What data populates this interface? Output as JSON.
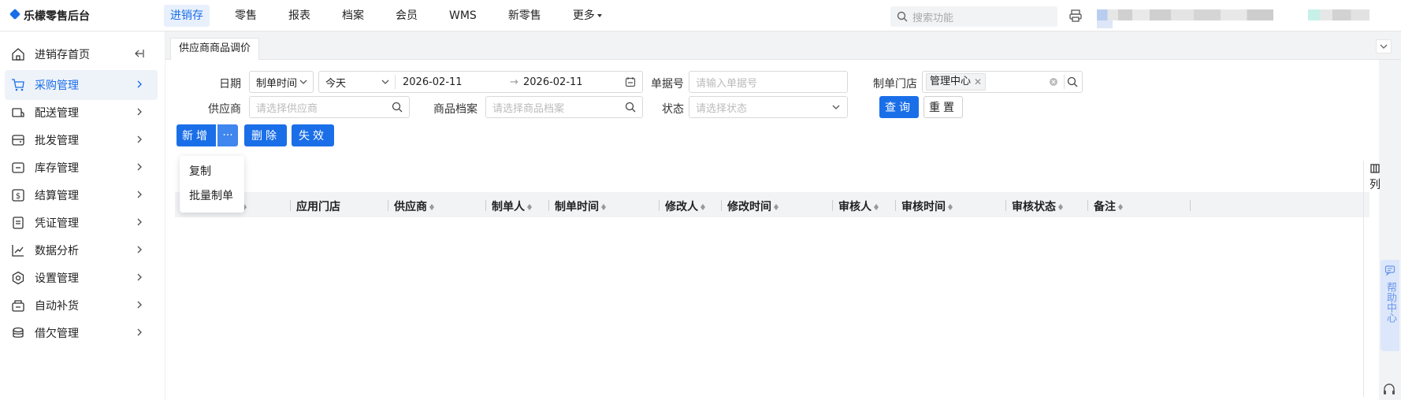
{
  "app": {
    "title": "乐檬零售后台"
  },
  "topnav": {
    "items": [
      {
        "label": "进销存",
        "active": true
      },
      {
        "label": "零售"
      },
      {
        "label": "报表"
      },
      {
        "label": "档案"
      },
      {
        "label": "会员"
      },
      {
        "label": "WMS"
      },
      {
        "label": "新零售"
      },
      {
        "label": "更多"
      }
    ],
    "search_placeholder": "搜索功能"
  },
  "sidebar": {
    "items": [
      {
        "label": "进销存首页",
        "icon": "home-icon"
      },
      {
        "label": "采购管理",
        "icon": "cart-icon",
        "active": true
      },
      {
        "label": "配送管理",
        "icon": "delivery-icon"
      },
      {
        "label": "批发管理",
        "icon": "wallet-icon"
      },
      {
        "label": "库存管理",
        "icon": "inventory-icon"
      },
      {
        "label": "结算管理",
        "icon": "dollar-icon"
      },
      {
        "label": "凭证管理",
        "icon": "voucher-icon"
      },
      {
        "label": "数据分析",
        "icon": "chart-icon"
      },
      {
        "label": "设置管理",
        "icon": "settings-icon"
      },
      {
        "label": "自动补货",
        "icon": "restock-icon"
      },
      {
        "label": "借欠管理",
        "icon": "coins-icon"
      }
    ]
  },
  "tabs": [
    {
      "label": "供应商商品调价"
    }
  ],
  "filters": {
    "date_label": "日期",
    "date_type": "制单时间",
    "date_range_preset": "今天",
    "date_start": "2026-02-11",
    "date_end": "2026-02-11",
    "doc_no_label": "单据号",
    "doc_no_placeholder": "请输入单据号",
    "store_label": "制单门店",
    "store_tag": "管理中心",
    "supplier_label": "供应商",
    "supplier_placeholder": "请选择供应商",
    "product_label": "商品档案",
    "product_placeholder": "请选择商品档案",
    "status_label": "状态",
    "status_placeholder": "请选择状态",
    "query_button": "查询",
    "reset_button": "重置"
  },
  "actions": {
    "add_button": "新增",
    "delete_button": "删除",
    "invalidate_button": "失效",
    "more_menu": [
      "复制",
      "批量制单"
    ]
  },
  "table": {
    "columns": [
      "号",
      "应用门店",
      "供应商",
      "制单人",
      "制单时间",
      "修改人",
      "修改时间",
      "审核人",
      "审核时间",
      "审核状态",
      "备注"
    ]
  },
  "right_panel": {
    "column_settings": "列",
    "help_center": "帮助中心"
  }
}
